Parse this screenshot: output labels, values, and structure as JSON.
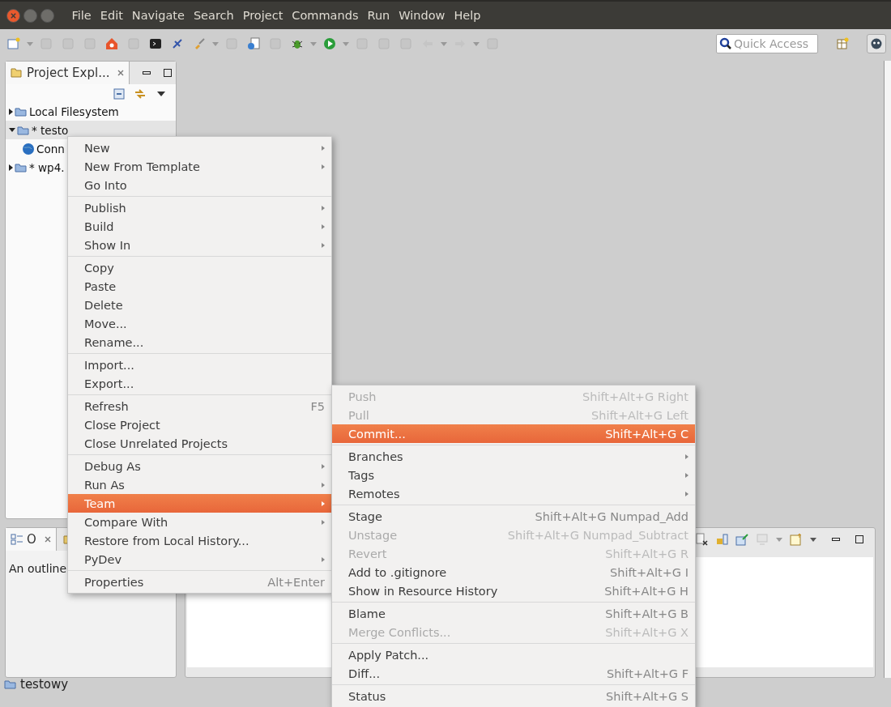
{
  "window": {
    "menu": [
      "File",
      "Edit",
      "Navigate",
      "Search",
      "Project",
      "Commands",
      "Run",
      "Window",
      "Help"
    ]
  },
  "quick_access": {
    "placeholder": "Quick Access"
  },
  "project_explorer": {
    "tab": "Project Expl...",
    "tree": [
      {
        "label": "Local Filesystem",
        "expanded": false,
        "selected": false
      },
      {
        "label": "* testo",
        "expanded": true,
        "selected": true,
        "children": [
          {
            "label": "Conn"
          }
        ]
      },
      {
        "label": "* wp4.",
        "expanded": false,
        "selected": false
      }
    ]
  },
  "outline": {
    "tab": "O",
    "message": "An outline"
  },
  "context_menu": {
    "groups": [
      [
        {
          "label": "New",
          "submenu": true,
          "selected": false
        },
        {
          "label": "New From Template",
          "submenu": true,
          "selected": false
        },
        {
          "label": "Go Into",
          "submenu": false,
          "selected": false
        }
      ],
      [
        {
          "label": "Publish",
          "submenu": true,
          "selected": false
        },
        {
          "label": "Build",
          "submenu": true,
          "selected": false
        },
        {
          "label": "Show In",
          "submenu": true,
          "selected": false
        }
      ],
      [
        {
          "label": "Copy",
          "submenu": false,
          "selected": false
        },
        {
          "label": "Paste",
          "submenu": false,
          "selected": false
        },
        {
          "label": "Delete",
          "submenu": false,
          "selected": false
        },
        {
          "label": "Move...",
          "submenu": false,
          "selected": false
        },
        {
          "label": "Rename...",
          "submenu": false,
          "selected": false
        }
      ],
      [
        {
          "label": "Import...",
          "submenu": false,
          "selected": false
        },
        {
          "label": "Export...",
          "submenu": false,
          "selected": false
        }
      ],
      [
        {
          "label": "Refresh",
          "shortcut": "F5",
          "submenu": false,
          "selected": false
        },
        {
          "label": "Close Project",
          "submenu": false,
          "selected": false
        },
        {
          "label": "Close Unrelated Projects",
          "submenu": false,
          "selected": false
        }
      ],
      [
        {
          "label": "Debug As",
          "submenu": true,
          "selected": false
        },
        {
          "label": "Run As",
          "submenu": true,
          "selected": false
        },
        {
          "label": "Team",
          "submenu": true,
          "selected": true
        },
        {
          "label": "Compare With",
          "submenu": true,
          "selected": false
        },
        {
          "label": "Restore from Local History...",
          "submenu": false,
          "selected": false
        },
        {
          "label": "PyDev",
          "submenu": true,
          "selected": false
        }
      ],
      [
        {
          "label": "Properties",
          "shortcut": "Alt+Enter",
          "submenu": false,
          "selected": false
        }
      ]
    ]
  },
  "team_menu": {
    "groups": [
      [
        {
          "label": "Push",
          "shortcut": "Shift+Alt+G Right",
          "disabled": true,
          "submenu": false,
          "selected": false
        },
        {
          "label": "Pull",
          "shortcut": "Shift+Alt+G Left",
          "disabled": true,
          "submenu": false,
          "selected": false
        },
        {
          "label": "Commit...",
          "shortcut": "Shift+Alt+G C",
          "disabled": false,
          "submenu": false,
          "selected": true
        }
      ],
      [
        {
          "label": "Branches",
          "disabled": false,
          "submenu": true,
          "selected": false
        },
        {
          "label": "Tags",
          "disabled": false,
          "submenu": true,
          "selected": false
        },
        {
          "label": "Remotes",
          "disabled": false,
          "submenu": true,
          "selected": false
        }
      ],
      [
        {
          "label": "Stage",
          "shortcut": "Shift+Alt+G Numpad_Add",
          "disabled": false,
          "submenu": false,
          "selected": false
        },
        {
          "label": "Unstage",
          "shortcut": "Shift+Alt+G Numpad_Subtract",
          "disabled": true,
          "submenu": false,
          "selected": false
        },
        {
          "label": "Revert",
          "shortcut": "Shift+Alt+G R",
          "disabled": true,
          "submenu": false,
          "selected": false
        },
        {
          "label": "Add to .gitignore",
          "shortcut": "Shift+Alt+G I",
          "disabled": false,
          "submenu": false,
          "selected": false
        },
        {
          "label": "Show in Resource History",
          "shortcut": "Shift+Alt+G H",
          "disabled": false,
          "submenu": false,
          "selected": false
        }
      ],
      [
        {
          "label": "Blame",
          "shortcut": "Shift+Alt+G B",
          "disabled": false,
          "submenu": false,
          "selected": false
        },
        {
          "label": "Merge Conflicts...",
          "shortcut": "Shift+Alt+G X",
          "disabled": true,
          "submenu": false,
          "selected": false
        }
      ],
      [
        {
          "label": "Apply Patch...",
          "disabled": false,
          "submenu": false,
          "selected": false
        },
        {
          "label": "Diff...",
          "shortcut": "Shift+Alt+G F",
          "disabled": false,
          "submenu": false,
          "selected": false
        }
      ],
      [
        {
          "label": "Status",
          "shortcut": "Shift+Alt+G S",
          "disabled": false,
          "submenu": false,
          "selected": false
        }
      ]
    ]
  },
  "status_bar": {
    "text": "testowy"
  }
}
